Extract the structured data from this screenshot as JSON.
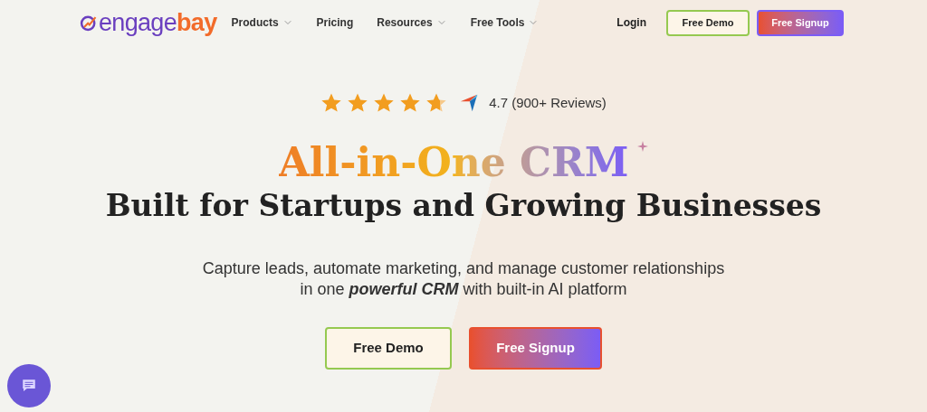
{
  "logo": {
    "parts": [
      "engage",
      "bay"
    ]
  },
  "nav": [
    {
      "label": "Products",
      "dropdown": true
    },
    {
      "label": "Pricing",
      "dropdown": false
    },
    {
      "label": "Resources",
      "dropdown": true
    },
    {
      "label": "Free Tools",
      "dropdown": true
    }
  ],
  "header_actions": {
    "login": "Login",
    "demo": "Free Demo",
    "signup": "Free Signup"
  },
  "rating": {
    "stars": 4.7,
    "text": "4.7 (900+ Reviews)"
  },
  "headline": "All-in-One CRM",
  "subheadline": "Built for Startups and Growing Businesses",
  "description": [
    "Capture leads, automate marketing, and manage customer relationships",
    "in one **powerful CRM** with built-in AI platform"
  ],
  "cta": {
    "demo": "Free Demo",
    "signup": "Free Signup"
  }
}
